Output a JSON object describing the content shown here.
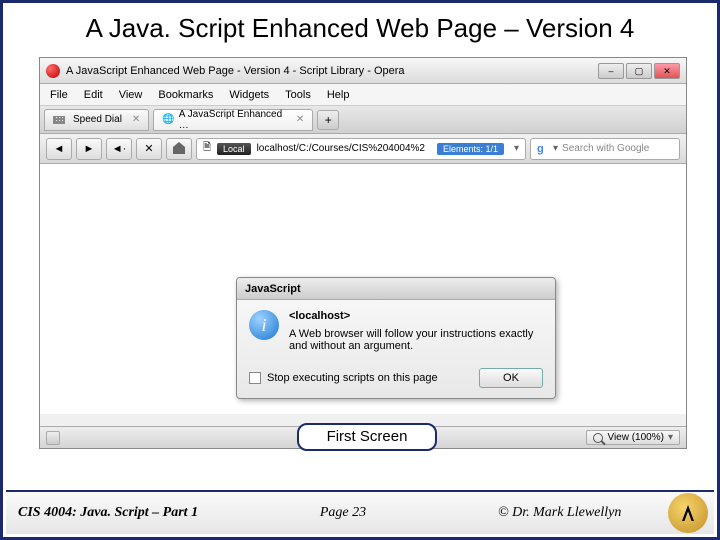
{
  "slide": {
    "title": "A Java. Script Enhanced Web Page – Version 4",
    "callout": "First Screen"
  },
  "footer": {
    "course": "CIS 4004: Java. Script – Part 1",
    "page": "Page 23",
    "copyright": "© Dr. Mark Llewellyn"
  },
  "browser": {
    "window_title": "A JavaScript Enhanced Web Page - Version 4 - Script Library - Opera",
    "menu": [
      "File",
      "Edit",
      "View",
      "Bookmarks",
      "Widgets",
      "Tools",
      "Help"
    ],
    "tabs": {
      "speed_dial": "Speed Dial",
      "active": "A JavaScript Enhanced …"
    },
    "address": {
      "local_badge": "Local",
      "url": "localhost/C:/Courses/CIS%204004%2",
      "elements_badge": "Elements: 1/1"
    },
    "search_placeholder": "Search with Google",
    "status": {
      "zoom_label": "View (100%)"
    }
  },
  "dialog": {
    "title": "JavaScript",
    "host": "<localhost>",
    "message": "A Web browser will follow your instructions exactly and without an argument.",
    "checkbox_label": "Stop executing scripts on this page",
    "ok": "OK"
  }
}
